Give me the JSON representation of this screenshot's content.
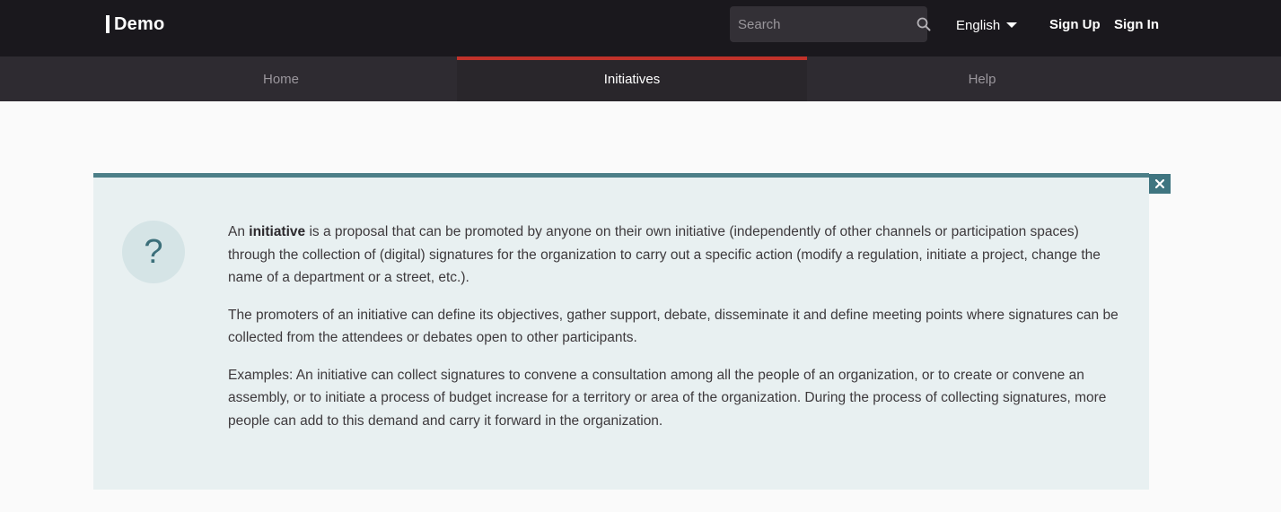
{
  "header": {
    "logo_text": "Demo",
    "search": {
      "placeholder": "Search",
      "value": "",
      "icon": "search-icon"
    },
    "language": {
      "selected": "English",
      "icon": "caret-down-icon"
    },
    "sign_up_label": "Sign Up",
    "sign_in_label": "Sign In"
  },
  "main_nav": {
    "items": [
      {
        "label": "Home",
        "active": false
      },
      {
        "label": "Initiatives",
        "active": true
      },
      {
        "label": "Help",
        "active": false
      }
    ]
  },
  "callout": {
    "icon": "question-mark",
    "icon_glyph": "?",
    "close_icon": "close-icon",
    "close_glyph": "✕",
    "paragraph1": {
      "before": "An ",
      "bold": "initiative",
      "after": " is a proposal that can be promoted by anyone on their own initiative (independently of other channels or participation spaces) through the collection of (digital) signatures for the organization to carry out a specific action (modify a regulation, initiate a project, change the name of a department or a street, etc.)."
    },
    "paragraph2": "The promoters of an initiative can define its objectives, gather support, debate, disseminate it and define meeting points where signatures can be collected from the attendees or debates open to other participants.",
    "paragraph3": "Examples: An initiative can collect signatures to convene a consultation among all the people of an organization, or to create or convene an assembly, or to initiate a process of budget increase for a territory or area of the organization. During the process of collecting signatures, more people can add to this demand and carry it forward in the organization."
  },
  "colors": {
    "topbar_bg": "#1a181d",
    "nav_bg": "#2e2b31",
    "active_tab_accent": "#c1322a",
    "callout_bg": "#e8f0f1",
    "callout_border": "#4c7f88"
  }
}
